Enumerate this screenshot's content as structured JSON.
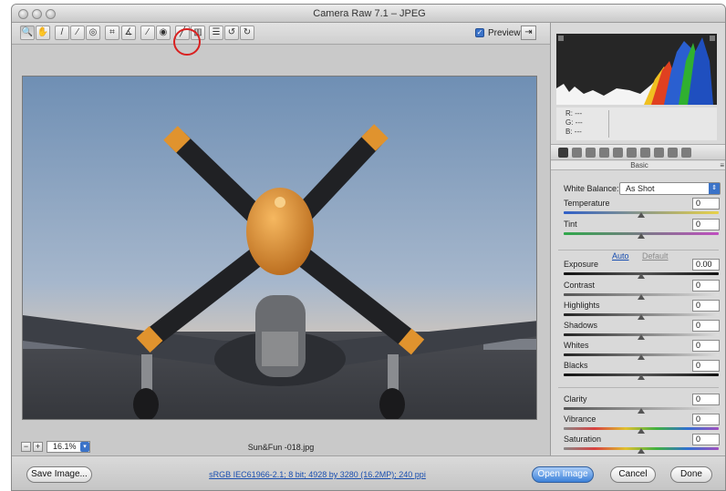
{
  "window": {
    "title": "Camera Raw 7.1  –  JPEG"
  },
  "toolbar": {
    "tools": [
      {
        "icon": "zoom-icon",
        "glyph": "🔍"
      },
      {
        "icon": "hand-icon",
        "glyph": "✋"
      },
      {
        "icon": "white-balance-icon",
        "glyph": "/"
      },
      {
        "icon": "color-sampler-icon",
        "glyph": "⁄"
      },
      {
        "icon": "targeted-adjustment-icon",
        "glyph": "◎"
      },
      {
        "icon": "crop-icon",
        "glyph": "⌗"
      },
      {
        "icon": "straighten-icon",
        "glyph": "∡"
      },
      {
        "icon": "spot-removal-icon",
        "glyph": "⁄"
      },
      {
        "icon": "red-eye-icon",
        "glyph": "◉"
      },
      {
        "icon": "adjustment-brush-icon",
        "glyph": "╱"
      },
      {
        "icon": "graduated-filter-icon",
        "glyph": "▥"
      },
      {
        "icon": "preferences-icon",
        "glyph": "☰"
      },
      {
        "icon": "rotate-ccw-icon",
        "glyph": "↺"
      },
      {
        "icon": "rotate-cw-icon",
        "glyph": "↻"
      }
    ],
    "preview_label": "Preview",
    "preview_checked": true
  },
  "status": {
    "zoom_value": "16.1%",
    "filename": "Sun&Fun -018.jpg"
  },
  "bottom": {
    "save_label": "Save Image...",
    "workflow_link": "sRGB IEC61966-2.1; 8 bit; 4928 by 3280 (16.2MP); 240 ppi",
    "open_label": "Open Image",
    "cancel_label": "Cancel",
    "done_label": "Done"
  },
  "readout": {
    "r": "R:   ---",
    "g": "G:   ---",
    "b": "B:   ---"
  },
  "panel": {
    "title": "Basic",
    "white_balance_label": "White Balance:",
    "white_balance_value": "As Shot",
    "auto_label": "Auto",
    "default_label": "Default",
    "sliders": [
      {
        "key": "temperature",
        "label": "Temperature",
        "value": "0",
        "level": 0.5
      },
      {
        "key": "tint",
        "label": "Tint",
        "value": "0",
        "level": 0.5
      },
      {
        "key": "exposure",
        "label": "Exposure",
        "value": "0.00",
        "level": 0.5
      },
      {
        "key": "contrast",
        "label": "Contrast",
        "value": "0",
        "level": 0.5
      },
      {
        "key": "highlights",
        "label": "Highlights",
        "value": "0",
        "level": 0.5
      },
      {
        "key": "shadows",
        "label": "Shadows",
        "value": "0",
        "level": 0.5
      },
      {
        "key": "whites",
        "label": "Whites",
        "value": "0",
        "level": 0.5
      },
      {
        "key": "blacks",
        "label": "Blacks",
        "value": "0",
        "level": 0.5
      },
      {
        "key": "clarity",
        "label": "Clarity",
        "value": "0",
        "level": 0.5
      },
      {
        "key": "vibrance",
        "label": "Vibrance",
        "value": "0",
        "level": 0.5
      },
      {
        "key": "saturation",
        "label": "Saturation",
        "value": "0",
        "level": 0.5
      }
    ]
  },
  "colors": {
    "accent": "#3b73c8",
    "highlight_ring": "#d92020"
  }
}
